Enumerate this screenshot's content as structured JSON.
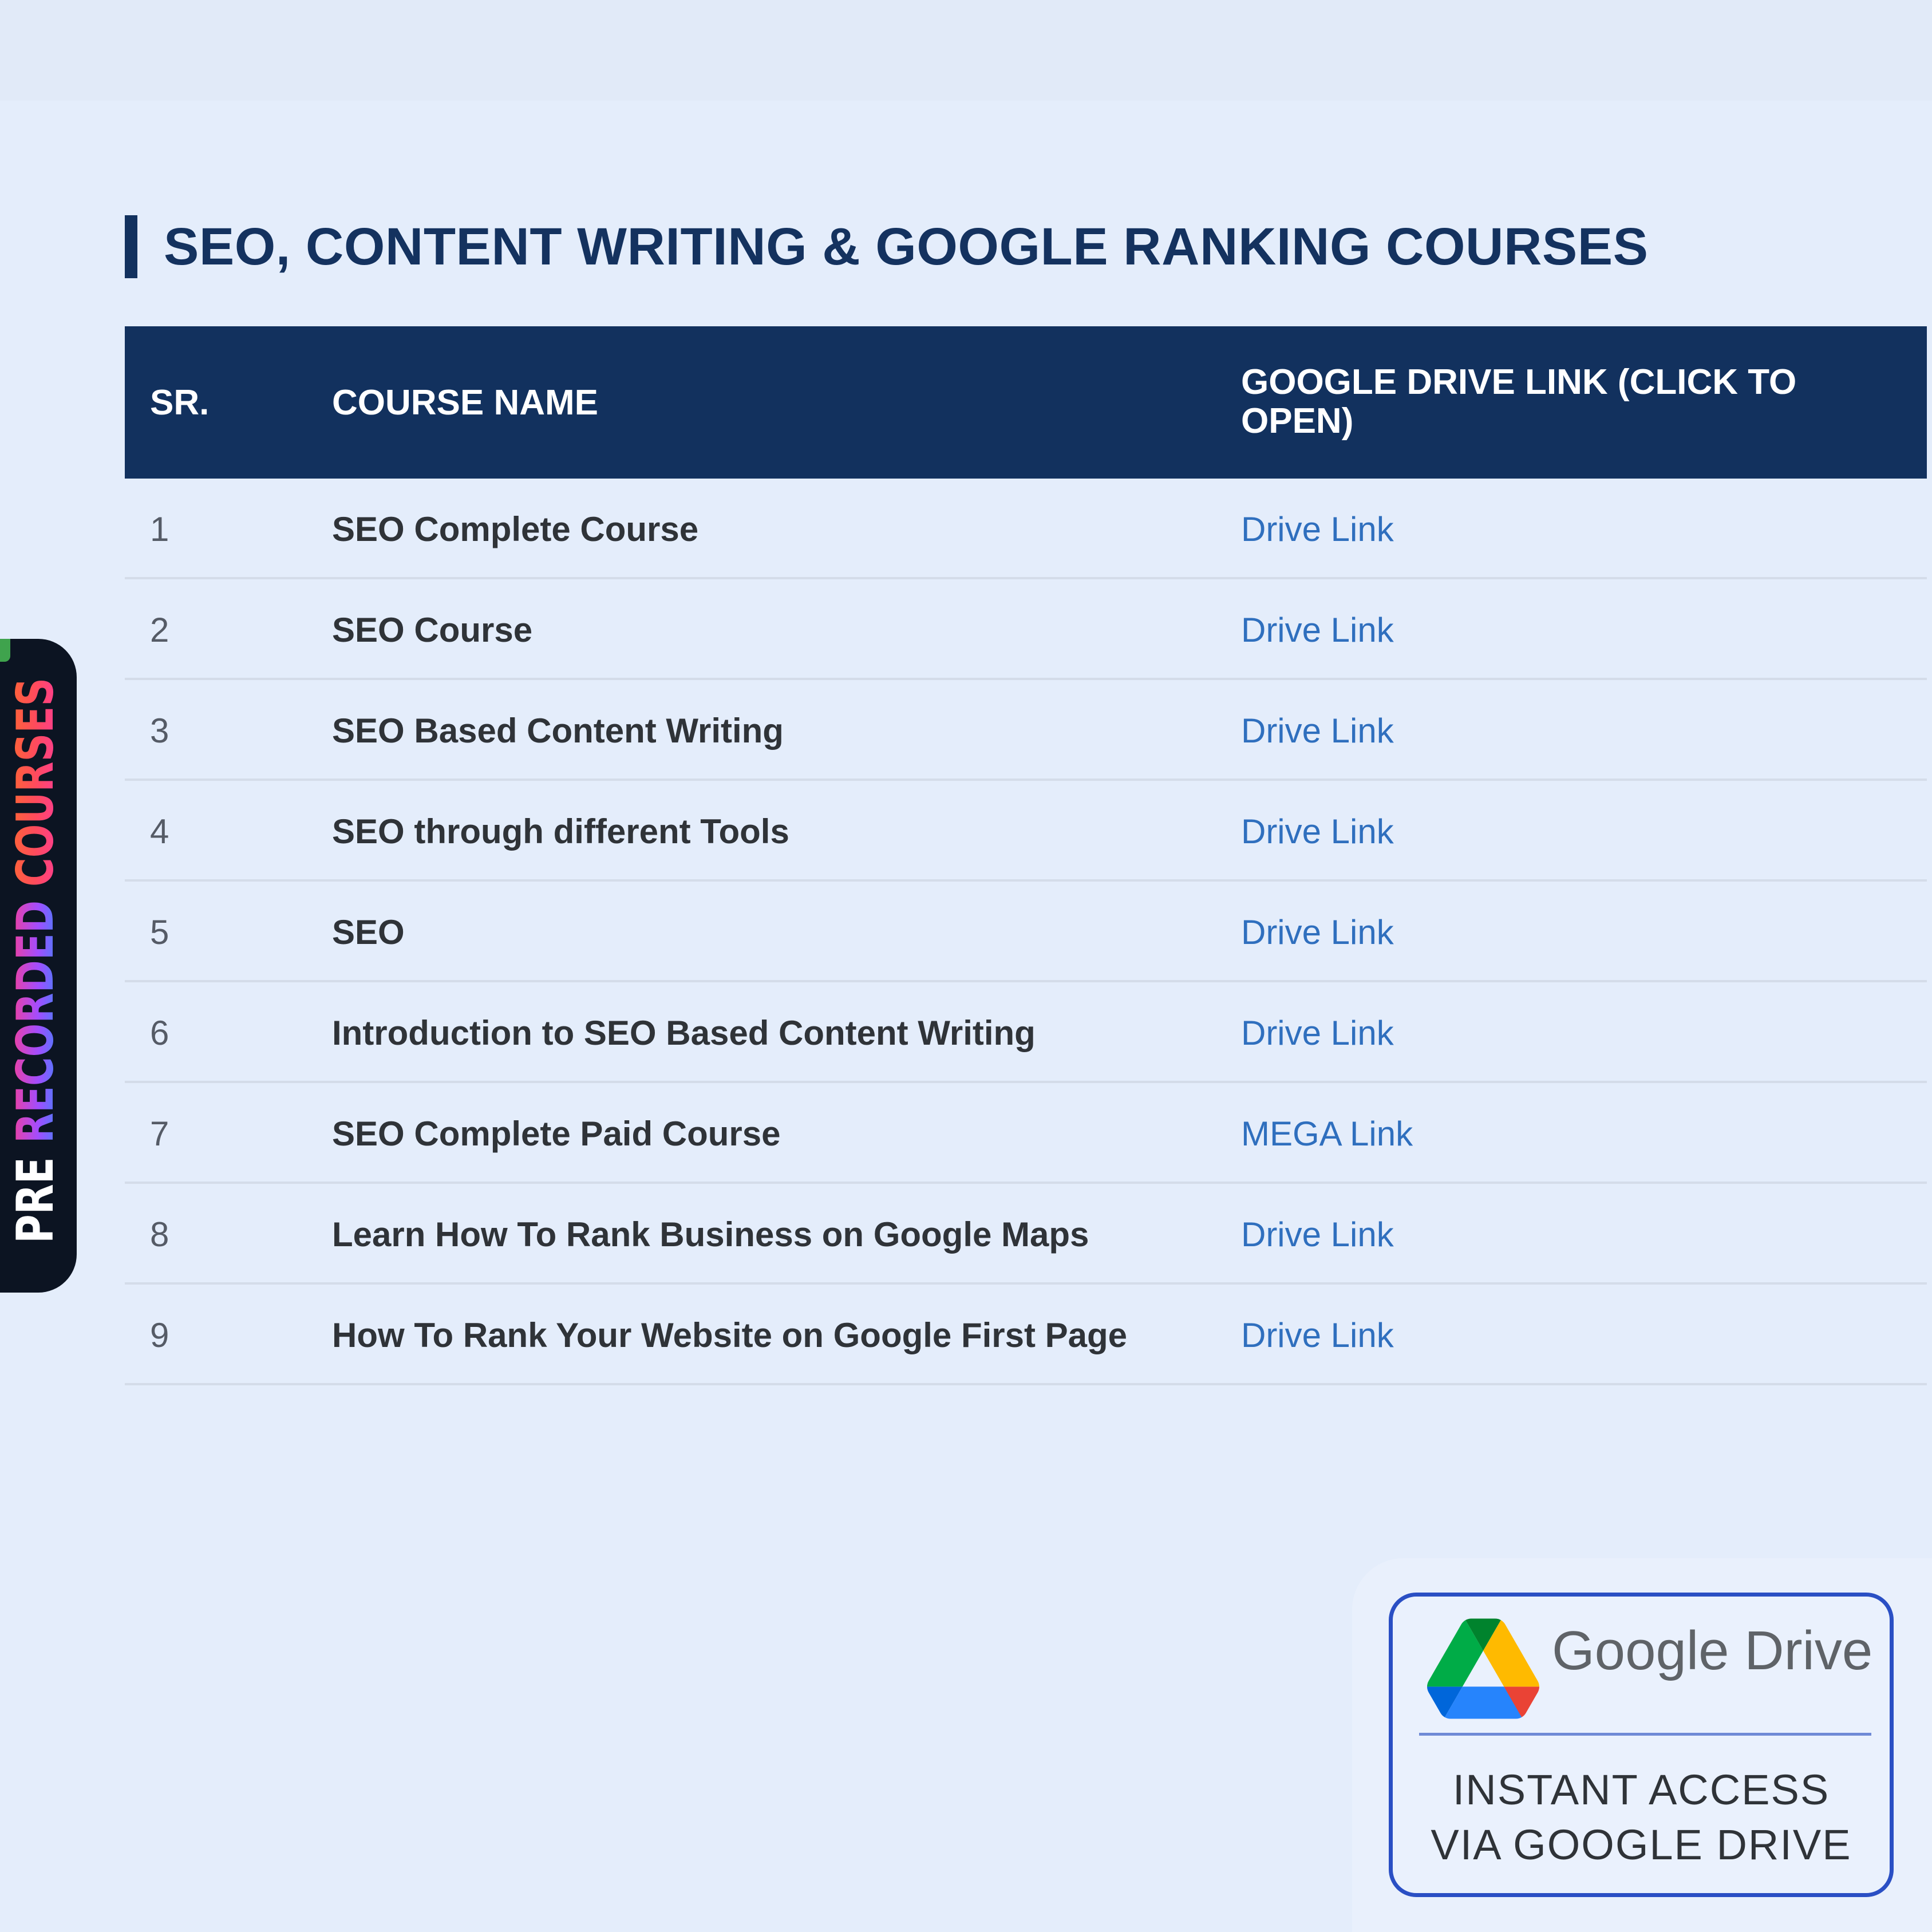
{
  "section": {
    "title": "SEO, CONTENT WRITING & GOOGLE RANKING COURSES"
  },
  "table": {
    "headers": {
      "sr": "SR.",
      "name": "COURSE NAME",
      "link": "GOOGLE DRIVE LINK (CLICK TO OPEN)"
    },
    "rows": [
      {
        "sr": "1",
        "name": "SEO Complete Course",
        "link": "Drive Link"
      },
      {
        "sr": "2",
        "name": "SEO Course",
        "link": "Drive Link"
      },
      {
        "sr": "3",
        "name": "SEO Based Content Writing",
        "link": "Drive Link"
      },
      {
        "sr": "4",
        "name": "SEO through different Tools",
        "link": "Drive Link"
      },
      {
        "sr": "5",
        "name": "SEO",
        "link": "Drive Link"
      },
      {
        "sr": "6",
        "name": "Introduction to SEO Based Content Writing",
        "link": "Drive Link"
      },
      {
        "sr": "7",
        "name": "SEO Complete Paid Course",
        "link": "MEGA Link"
      },
      {
        "sr": "8",
        "name": "Learn How To Rank Business on Google Maps",
        "link": "Drive Link"
      },
      {
        "sr": "9",
        "name": "How To Rank Your Website on Google First Page",
        "link": "Drive Link"
      }
    ]
  },
  "side_badge": {
    "word1": "PRE",
    "word2": "RECORDED",
    "word3": "COURSES"
  },
  "drive_card": {
    "logo_icon": "google-drive-icon",
    "brand": "Google Drive",
    "line1": "INSTANT ACCESS",
    "line2": "VIA GOOGLE DRIVE"
  },
  "colors": {
    "header_bg": "#12315e",
    "title": "#14325f",
    "link": "#2f6fbe",
    "page_bg": "#e4edfb",
    "card_border": "#2a4fc4"
  }
}
